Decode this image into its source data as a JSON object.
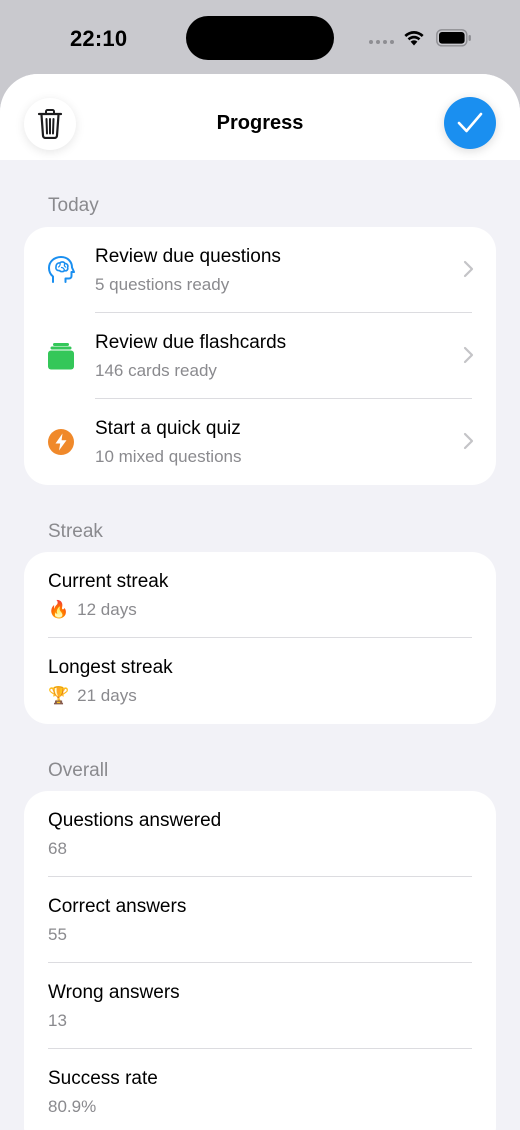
{
  "status_bar": {
    "time": "22:10"
  },
  "nav": {
    "title": "Progress",
    "left_icon": "trash-icon",
    "right_icon": "checkmark-icon"
  },
  "colors": {
    "accent_blue": "#1a8ff0",
    "flashcard_green": "#34c759",
    "quiz_orange": "#f0892a",
    "secondary_text": "#8a8a8e"
  },
  "today": {
    "header": "Today",
    "items": [
      {
        "icon": "brain-head-icon",
        "title": "Review due questions",
        "subtitle": "5 questions ready"
      },
      {
        "icon": "card-stack-icon",
        "title": "Review due flashcards",
        "subtitle": "146 cards ready"
      },
      {
        "icon": "bolt-circle-icon",
        "title": "Start a quick quiz",
        "subtitle": "10 mixed questions"
      }
    ]
  },
  "streak": {
    "header": "Streak",
    "items": [
      {
        "title": "Current streak",
        "emoji": "🔥",
        "value": "12 days"
      },
      {
        "title": "Longest streak",
        "emoji": "🏆",
        "value": "21 days"
      }
    ]
  },
  "overall": {
    "header": "Overall",
    "items": [
      {
        "title": "Questions answered",
        "value": "68"
      },
      {
        "title": "Correct answers",
        "value": "55"
      },
      {
        "title": "Wrong answers",
        "value": "13"
      },
      {
        "title": "Success rate",
        "value": "80.9%"
      }
    ]
  }
}
